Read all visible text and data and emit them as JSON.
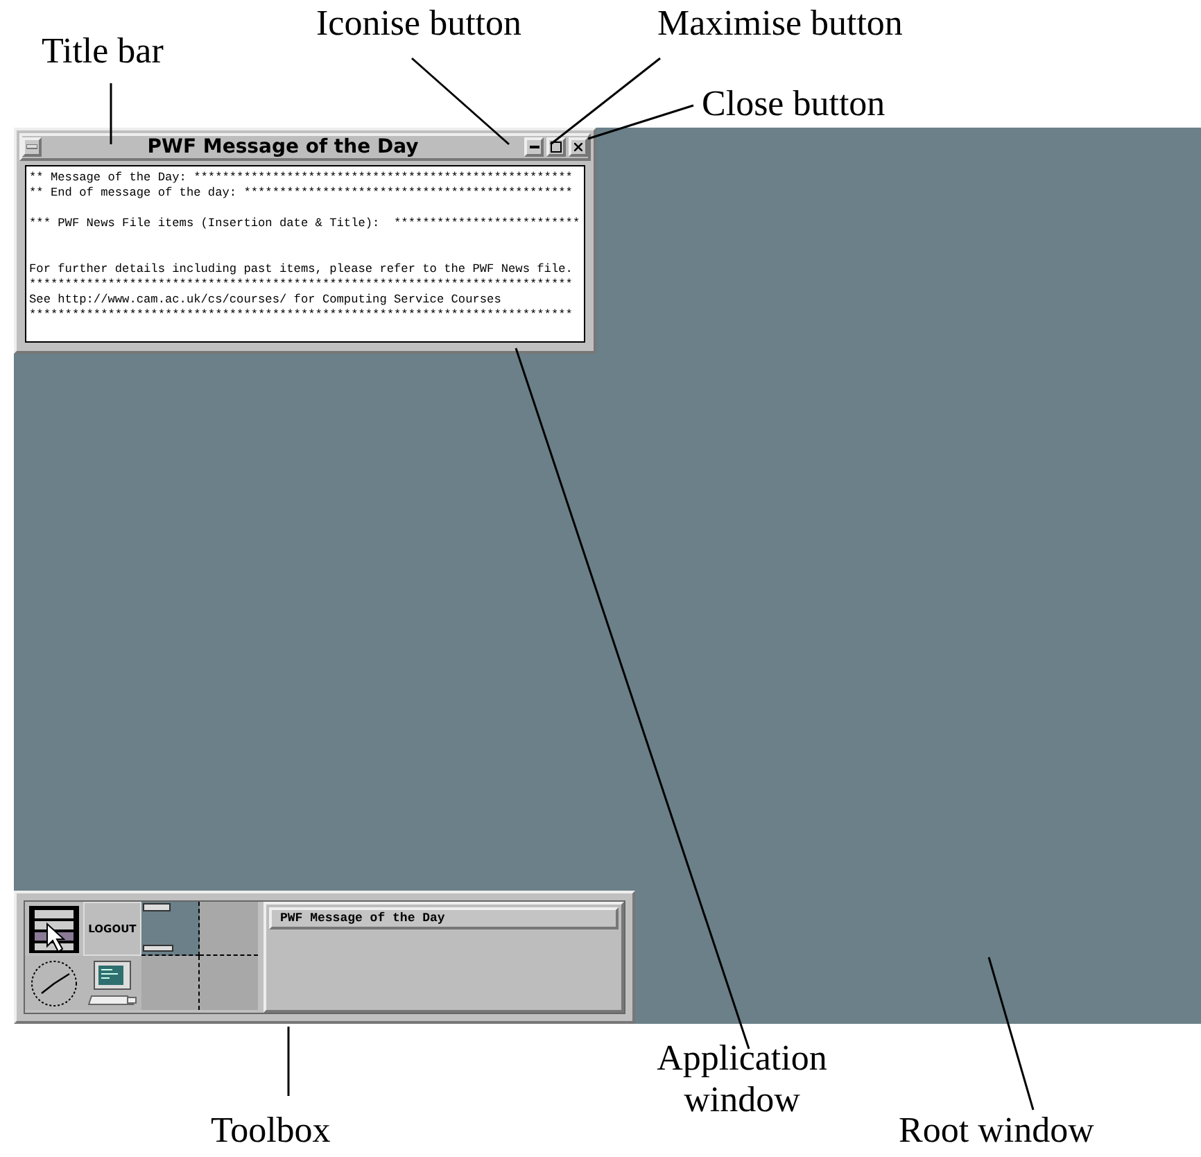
{
  "annotations": [
    {
      "label": "Title bar"
    },
    {
      "label": "Iconise button"
    },
    {
      "label": "Maximise button"
    },
    {
      "label": "Close button"
    },
    {
      "label": "Toolbox"
    },
    {
      "label": "Application window"
    },
    {
      "label": "Root window"
    }
  ],
  "window": {
    "title": "PWF Message of the Day",
    "lines": [
      {
        "text": "** Message of the Day: *****************************************************",
        "kind": "line"
      },
      {
        "text": "** End of message of the day: **********************************************",
        "kind": "line"
      },
      {
        "text": "*** PWF News File items (Insertion date & Title):  **************************",
        "kind": "spaced"
      },
      {
        "text": "For further details including past items, please refer to the PWF News file.",
        "kind": "wide"
      },
      {
        "text": "****************************************************************************",
        "kind": "line"
      },
      {
        "text": "See http://www.cam.ac.uk/cs/courses/ for Computing Service Courses",
        "kind": "line"
      },
      {
        "text": "****************************************************************************",
        "kind": "line"
      }
    ]
  },
  "toolbox": {
    "logout": "LOGOUT",
    "tasks": [
      {
        "title": "PWF Message of the Day"
      }
    ]
  }
}
